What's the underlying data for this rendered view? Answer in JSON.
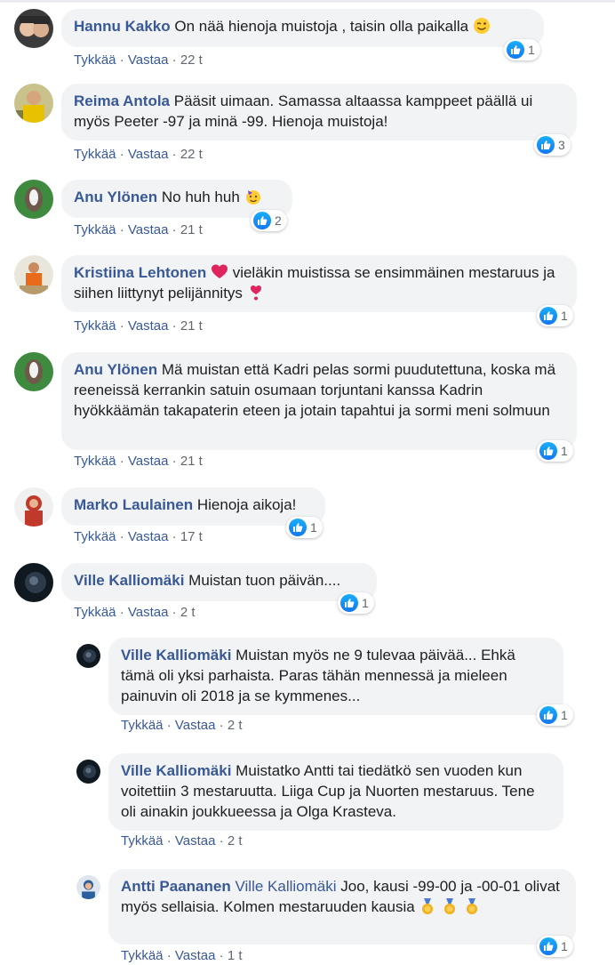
{
  "action_labels": {
    "like": "Tykkää",
    "reply": "Vastaa",
    "sep": "·"
  },
  "comments": [
    {
      "author": "Hannu Kakko",
      "text": "On nää hienoja muistoja , taisin olla paikalla",
      "time": "22 t",
      "likes": "1"
    },
    {
      "author": "Reima Antola",
      "text": "Pääsit uimaan. Samassa altaassa kamppeet päällä ui myös Peeter -97 ja minä -99. Hienoja muistoja!",
      "time": "22 t",
      "likes": "3"
    },
    {
      "author": "Anu Ylönen",
      "text": "No huh huh",
      "time": "21 t",
      "likes": "2"
    },
    {
      "author": "Kristiina Lehtonen",
      "text_a": "vieläkin muistissa se ensimmäinen mestaruus ja siihen liittynyt pelijännitys",
      "time": "21 t",
      "likes": "1"
    },
    {
      "author": "Anu Ylönen",
      "text": "Mä muistan että Kadri pelas sormi puudutettuna, koska mä reeneissä kerrankin satuin osumaan torjuntani kanssa Kadrin hyökkäämän takapaterin eteen ja jotain tapahtui ja sormi meni solmuun",
      "time": "21 t",
      "likes": "1"
    },
    {
      "author": "Marko Laulainen",
      "text": "Hienoja aikoja!",
      "time": "17 t",
      "likes": "1"
    },
    {
      "author": "Ville Kalliomäki",
      "text": "Muistan tuon päivän....",
      "time": "2 t",
      "likes": "1"
    },
    {
      "author": "Ville Kalliomäki",
      "text": "Muistan myös ne 9 tulevaa päivää... Ehkä tämä oli yksi parhaista. Paras tähän mennessä ja mieleen painuvin oli 2018 ja se kymmenes...",
      "time": "2 t",
      "likes": "1"
    },
    {
      "author": "Ville Kalliomäki",
      "text": "Muistatko Antti tai tiedätkö sen vuoden kun voitettiin 3 mestaruutta. Liiga Cup ja Nuorten mestaruus. Tene oli ainakin joukkueessa ja Olga Krasteva.",
      "time": "2 t",
      "likes": ""
    },
    {
      "author": "Antti Paananen",
      "mention": "Ville Kalliomäki",
      "text": "Joo, kausi -99-00 ja -00-01 olivat myös sellaisia. Kolmen mestaruuden kausia",
      "time": "1 t",
      "likes": "1"
    }
  ],
  "colors": {
    "link": "#385898",
    "bubble": "#f2f3f5",
    "meta": "#606770",
    "like": "#1577f2"
  }
}
